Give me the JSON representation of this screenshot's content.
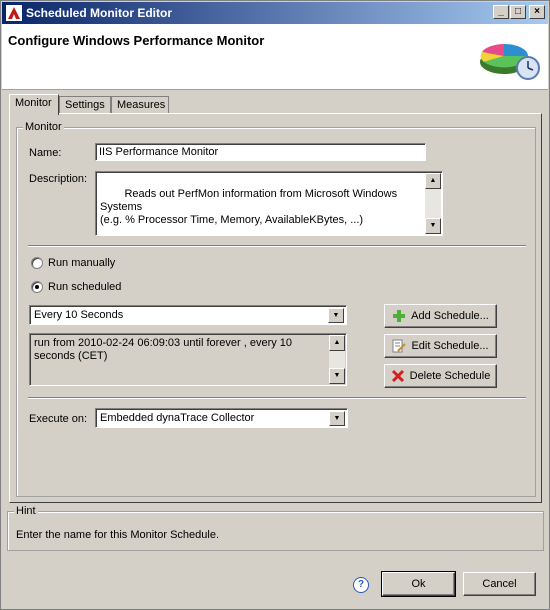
{
  "window": {
    "title": "Scheduled Monitor Editor",
    "minimize_glyph": "_",
    "maximize_glyph": "□",
    "close_glyph": "×"
  },
  "banner": {
    "heading": "Configure Windows Performance Monitor",
    "icon": "pie-chart-clock-icon"
  },
  "tabs": [
    {
      "label": "Monitor",
      "active": true
    },
    {
      "label": "Settings",
      "active": false
    },
    {
      "label": "Measures",
      "active": false
    }
  ],
  "monitor_group": {
    "legend": "Monitor",
    "name_label": "Name:",
    "name_value": "IIS Performance Monitor",
    "description_label": "Description:",
    "description_value": "Reads out PerfMon information from Microsoft Windows Systems\n(e.g. % Processor Time, Memory, AvailableKBytes, ...)"
  },
  "run": {
    "manual_label": "Run manually",
    "scheduled_label": "Run scheduled",
    "selected": "scheduled"
  },
  "schedule": {
    "selected": "Every 10 Seconds",
    "details": "run from 2010-02-24 06:09:03 until forever , every 10 seconds (CET)",
    "add_label": "Add Schedule...",
    "edit_label": "Edit Schedule...",
    "delete_label": "Delete Schedule"
  },
  "execute": {
    "label": "Execute on:",
    "selected": "Embedded dynaTrace Collector"
  },
  "hint": {
    "legend": "Hint",
    "text": "Enter the name for this Monitor Schedule."
  },
  "footer": {
    "help_glyph": "?",
    "ok_label": "Ok",
    "cancel_label": "Cancel"
  },
  "colors": {
    "window_bg": "#d4d0c8",
    "title_gradient_start": "#0a246a",
    "title_gradient_end": "#a6caf0",
    "add_icon": "#4caf3a",
    "delete_icon": "#d42020"
  }
}
